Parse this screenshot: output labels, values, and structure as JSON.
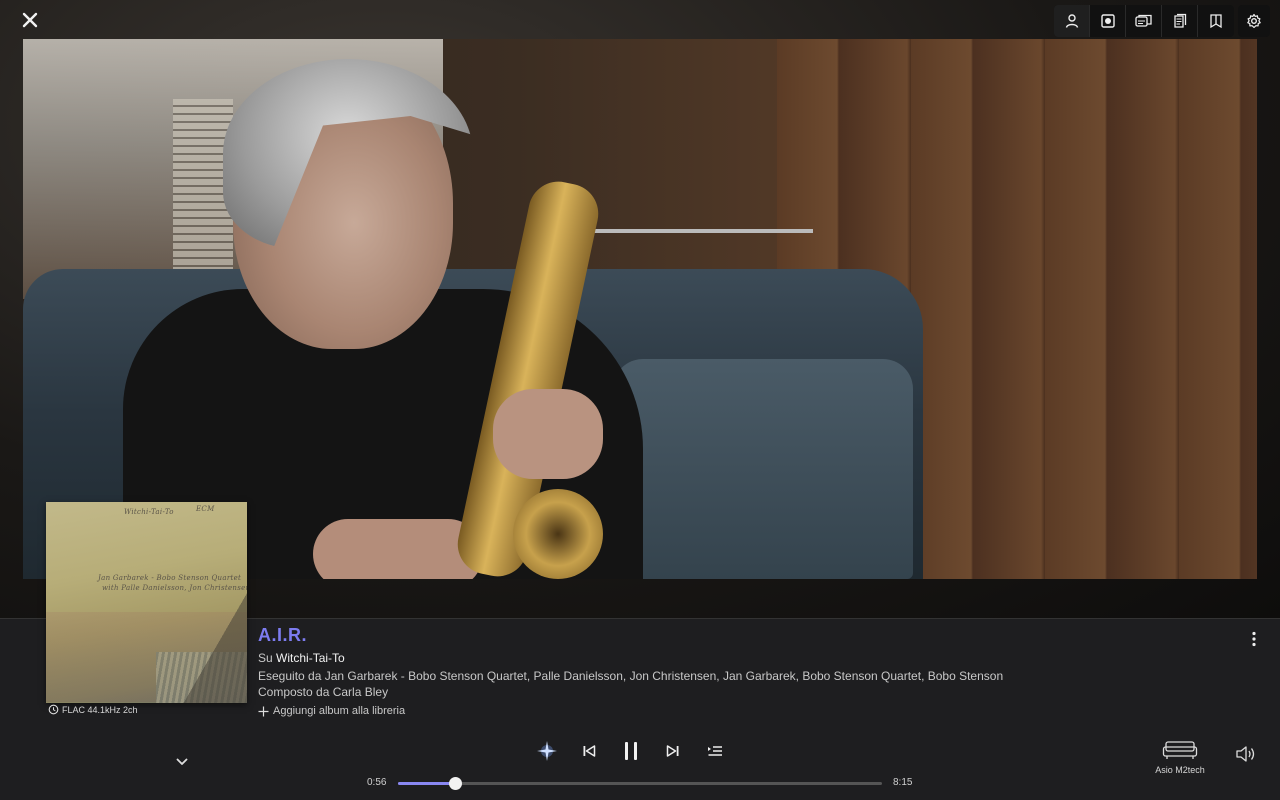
{
  "player": {
    "track_title": "A.I.R.",
    "album_prefix": "Su",
    "album_name": "Witchi-Tai-To",
    "performers_prefix": "Eseguito da",
    "performers": "Jan Garbarek - Bobo Stenson Quartet, Palle Danielsson, Jon Christensen, Jan Garbarek, Bobo Stenson Quartet, Bobo Stenson",
    "composer_prefix": "Composto da",
    "composer": "Carla Bley",
    "add_library_label": "Aggiungi album alla libreria",
    "format": "FLAC 44.1kHz 2ch",
    "time_current": "0:56",
    "time_total": "8:15",
    "progress_fraction": 0.118,
    "device_name": "Asio M2tech"
  },
  "album_cover": {
    "title_text": "Witchi-Tai-To",
    "line1": "Jan Garbarek - Bobo Stenson Quartet",
    "line2": "with Palle Danielsson, Jon Christensen",
    "small_text": "ECM"
  },
  "toolbar": {
    "buttons": [
      "user-icon",
      "record-icon",
      "stack-icon",
      "book-icon",
      "tag-icon",
      "gear-icon"
    ]
  },
  "colors": {
    "accent": "#7d7cf0",
    "progress": "#8a88f2",
    "panel_bg": "#1e1e20"
  }
}
